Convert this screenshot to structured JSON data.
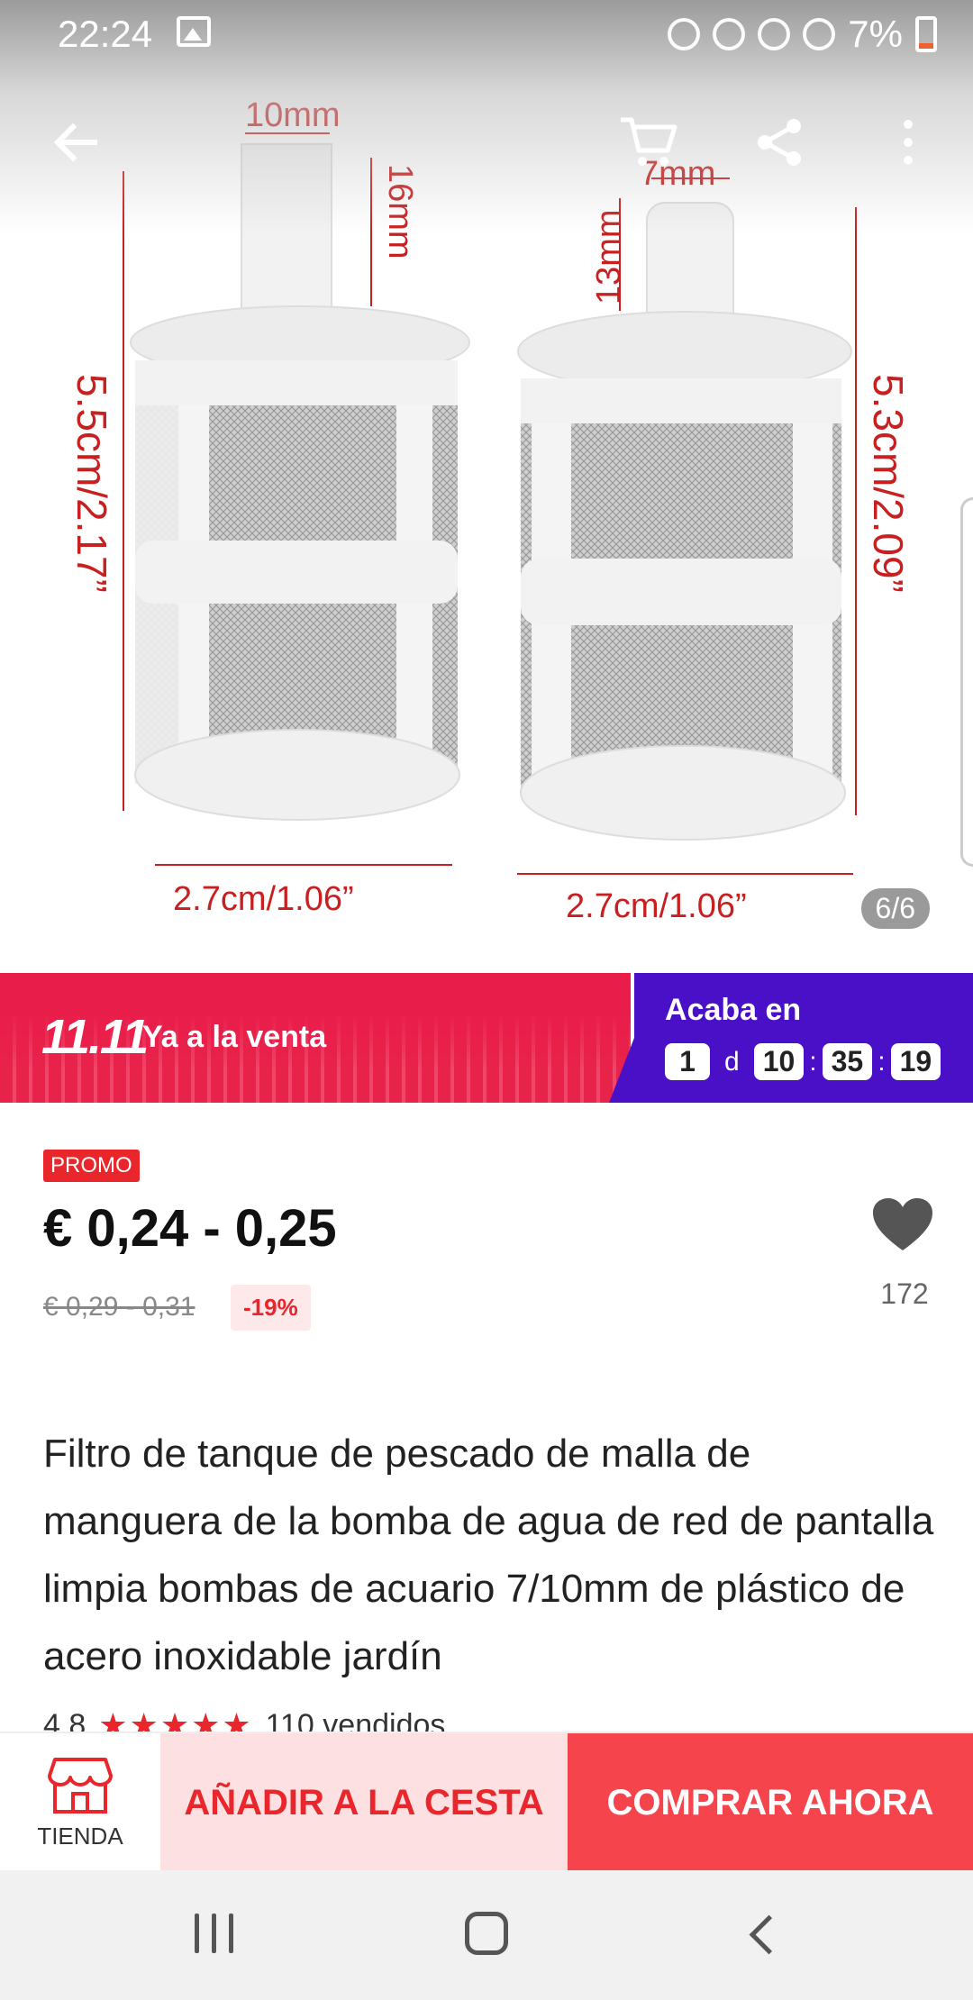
{
  "status_bar": {
    "time": "22:24",
    "battery": "7%"
  },
  "gallery": {
    "page_indicator": "6/6",
    "dimensions": {
      "left_top_width": "10mm",
      "left_neck_height": "16mm",
      "left_total_height": "5.5cm/2.17”",
      "left_bottom_width": "2.7cm/1.06”",
      "right_top_width": "7mm",
      "right_neck_height": "13mm",
      "right_total_height": "5.3cm/2.09”",
      "right_bottom_width": "2.7cm/1.06”"
    }
  },
  "promo_banner": {
    "event": "11.11",
    "status": "Ya a la venta",
    "ends_label": "Acaba en",
    "countdown": {
      "days": "1",
      "days_unit": "d",
      "hours": "10",
      "minutes": "35",
      "seconds": "19"
    }
  },
  "product": {
    "promo_tag": "PROMO",
    "price": "€ 0,24 - 0,25",
    "old_price": "€ 0,29 - 0,31",
    "discount": "-19%",
    "wishlist_count": "172",
    "title": "Filtro de tanque de pescado de malla de manguera de la bomba de agua de red de pantalla limpia bombas de acuario 7/10mm de plástico de acero inoxidable jardín",
    "rating": "4.8",
    "stars": "★★★★★",
    "sold": "110 vendidos"
  },
  "actions": {
    "store_label": "TIENDA",
    "add_to_cart": "AÑADIR A LA CESTA",
    "buy_now": "COMPRAR AHORA"
  },
  "colors": {
    "accent_red": "#e8262b",
    "banner_pink": "#e91d4a",
    "banner_purple": "#4a10c8",
    "buy_now_bg": "#f5444c",
    "add_cart_bg": "#fde1e2"
  }
}
